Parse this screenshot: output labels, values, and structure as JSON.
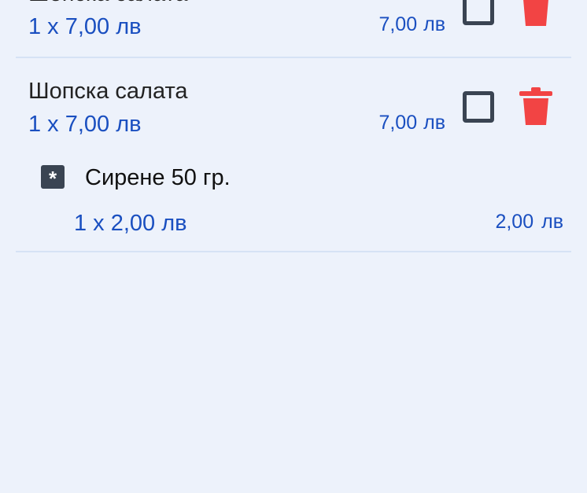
{
  "currency": "лв",
  "colors": {
    "background": "#edf2fb",
    "accent": "#1a4fc0",
    "delete": "#f24444",
    "checkbox": "#3a4452"
  },
  "items": [
    {
      "name": "Шопска салата",
      "quantity_text": "1 x 7,00",
      "total": "7,00",
      "checked": false
    },
    {
      "name": "Шопска салата",
      "quantity_text": "1 x 7,00",
      "total": "7,00",
      "checked": false,
      "modifiers": [
        {
          "icon": "asterisk-icon",
          "name": "Сирене 50 гр.",
          "quantity_text": "1 x 2,00",
          "total": "2,00"
        }
      ]
    }
  ]
}
